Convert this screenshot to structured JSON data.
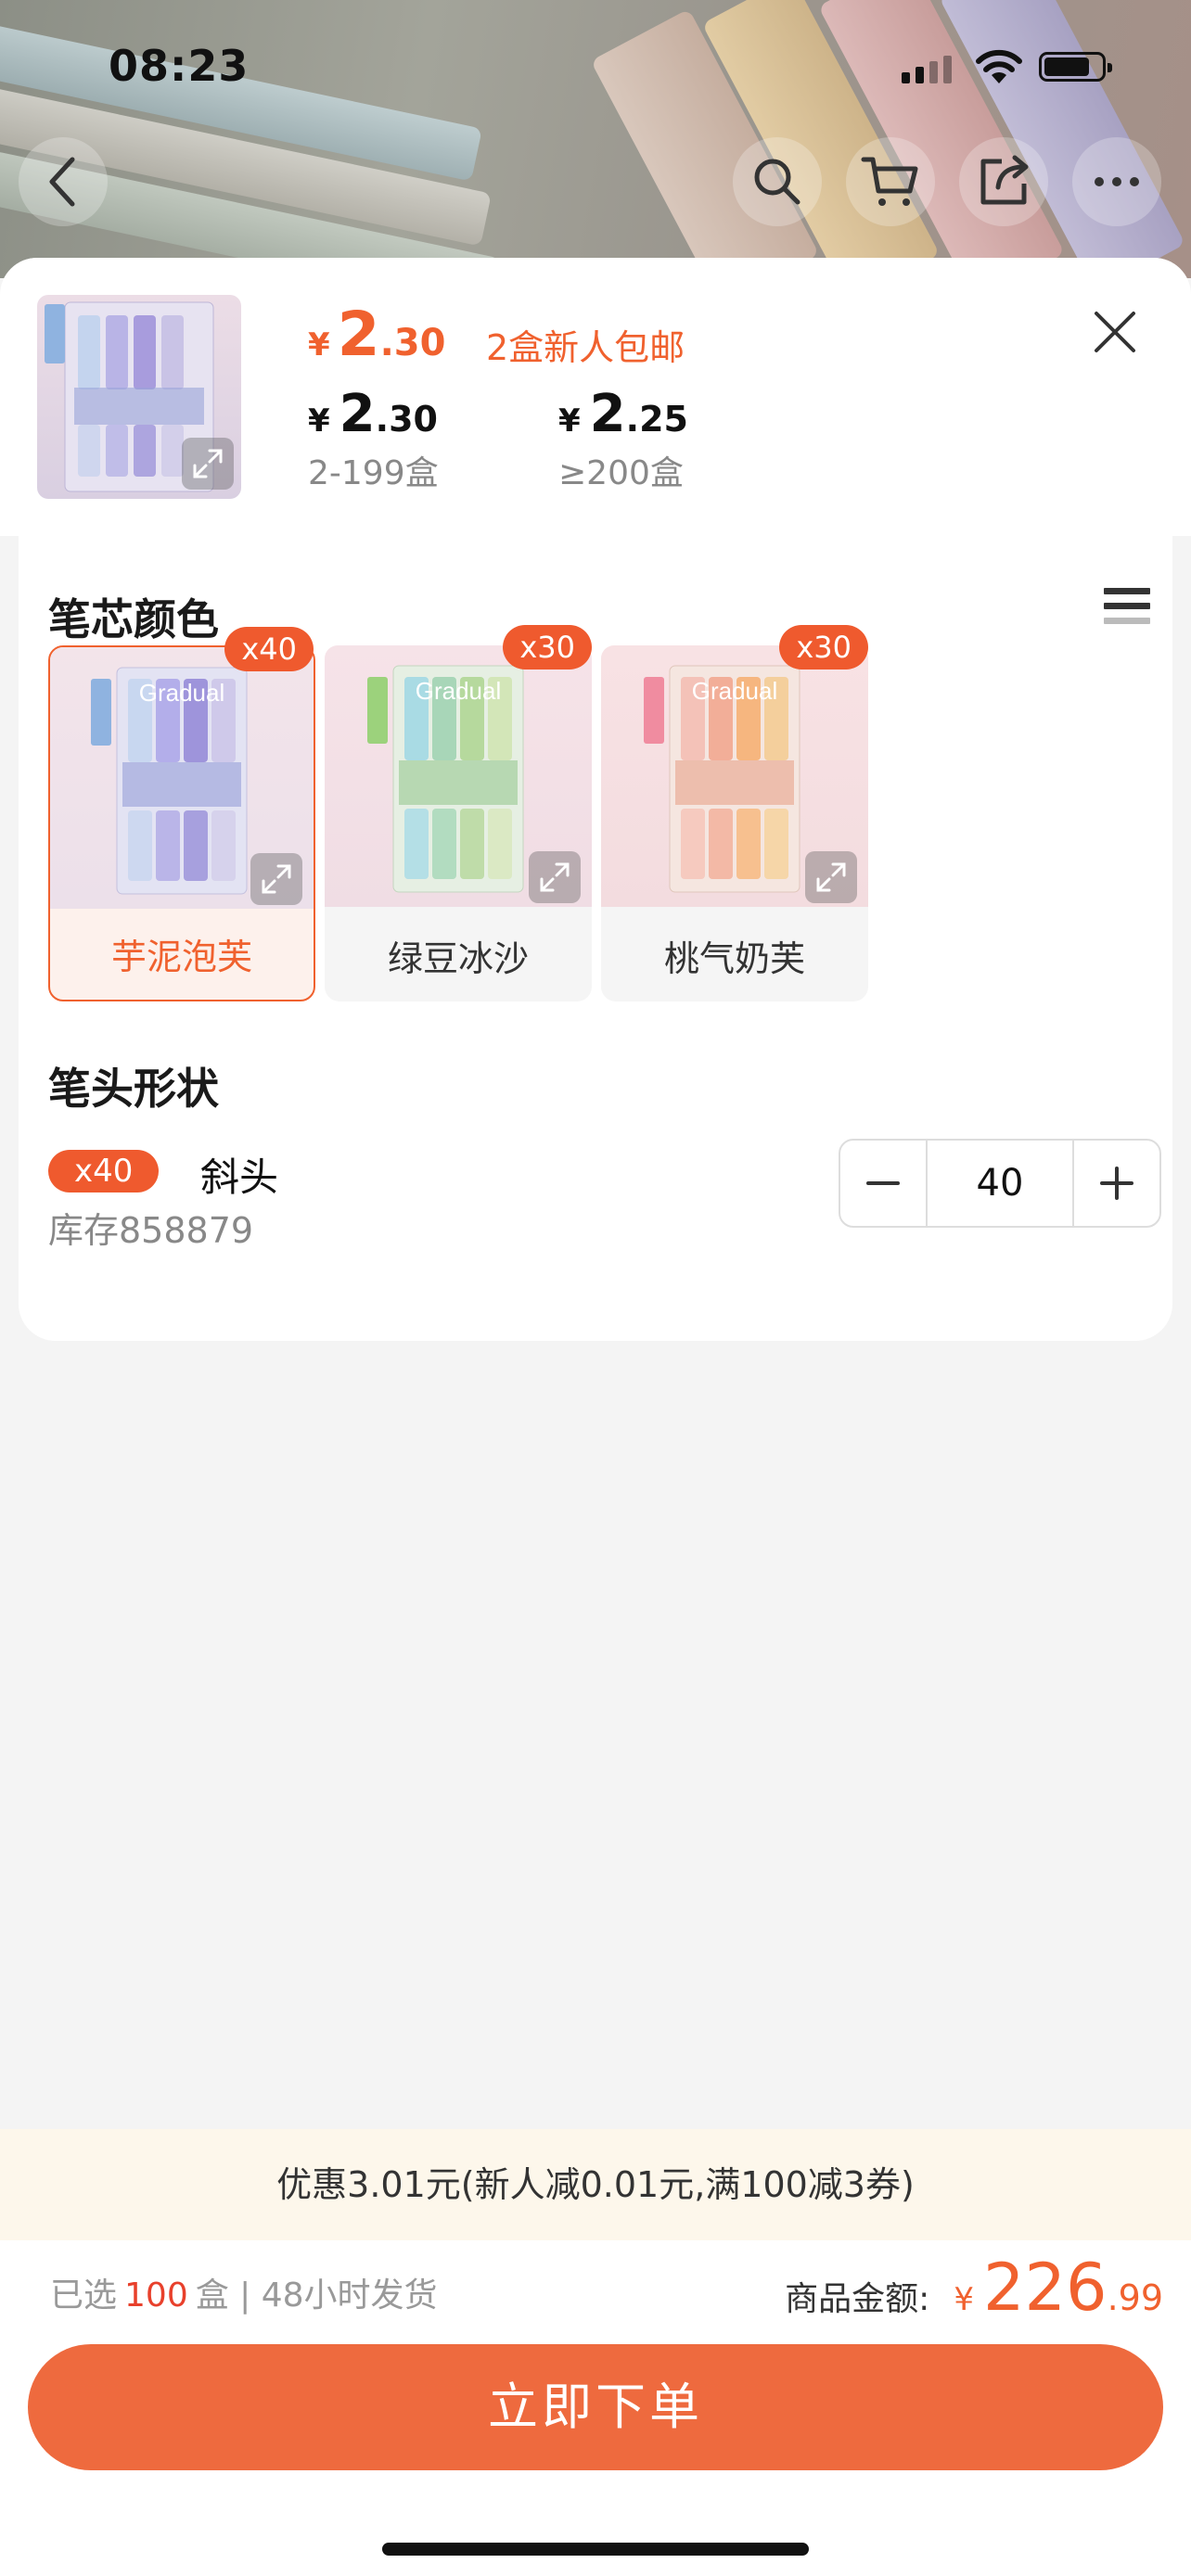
{
  "status_bar": {
    "time": "08:23"
  },
  "header": {
    "price": {
      "currency": "¥",
      "integer": "2",
      "decimal": ".30"
    },
    "promo": "2盒新人包邮",
    "tiers": [
      {
        "currency": "¥",
        "integer": "2",
        "decimal": ".30",
        "range": "2-199盒"
      },
      {
        "currency": "¥",
        "integer": "2",
        "decimal": ".25",
        "range": "≥200盒"
      }
    ]
  },
  "color_section": {
    "title": "笔芯颜色",
    "options": [
      {
        "name": "芋泥泡芙",
        "badge": "x40",
        "selected": true,
        "label_v": "芋泥泡芙",
        "tint": "#b7b3e6"
      },
      {
        "name": "绿豆冰沙",
        "badge": "x30",
        "selected": false,
        "label_v": "绿豆冰沙",
        "tint": "#a9d3a6"
      },
      {
        "name": "桃气奶芙",
        "badge": "x30",
        "selected": false,
        "label_v": "桃气奶芙",
        "tint": "#f2b899"
      }
    ],
    "box_text": "Gradual"
  },
  "shape_section": {
    "title": "笔头形状",
    "item": {
      "badge": "x40",
      "name": "斜头",
      "stock": "库存858879"
    },
    "quantity": "40"
  },
  "discount_bar": "优惠3.01元(新人减0.01元,满100减3券)",
  "summary": {
    "selected_prefix": "已选",
    "selected_count": "100",
    "selected_suffix": "盒 | 48小时发货",
    "total_label": "商品金额:",
    "currency": "¥",
    "total_integer": "226",
    "total_decimal": ".99"
  },
  "order_button": "立即下单",
  "colors": {
    "accent": "#f0612e",
    "button": "#ee6a3e",
    "badge": "#ef5a2e"
  }
}
